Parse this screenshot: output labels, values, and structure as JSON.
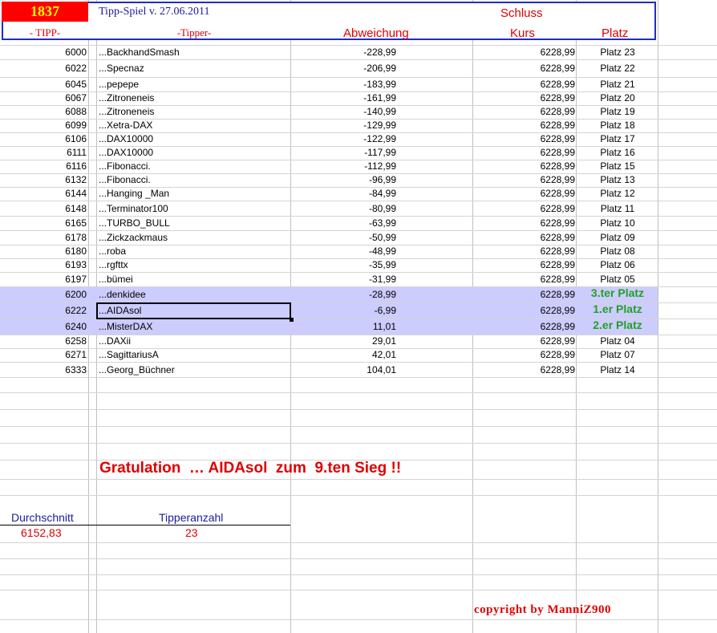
{
  "header": {
    "count": "1837",
    "title": "Tipp-Spiel v. 27.06.2011",
    "schluss": "Schluss",
    "col_tipp": "- TIPP-",
    "col_tipper": "-Tipper-",
    "col_abweichung": "Abweichung",
    "col_kurs": "Kurs",
    "col_platz": "Platz"
  },
  "rows": [
    {
      "tipp": "6000",
      "name": "...BackhandSmash",
      "abw": "-228,99",
      "kurs": "6228,99",
      "platz": "Platz 23"
    },
    {
      "tipp": "6022",
      "name": "...Specnaz",
      "abw": "-206,99",
      "kurs": "6228,99",
      "platz": "Platz 22"
    },
    {
      "tipp": "6045",
      "name": "...pepepe",
      "abw": "-183,99",
      "kurs": "6228,99",
      "platz": "Platz 21"
    },
    {
      "tipp": "6067",
      "name": "...Zitroneneis",
      "abw": "-161,99",
      "kurs": "6228,99",
      "platz": "Platz 20"
    },
    {
      "tipp": "6088",
      "name": "...Zitroneneis",
      "abw": "-140,99",
      "kurs": "6228,99",
      "platz": "Platz 19"
    },
    {
      "tipp": "6099",
      "name": "...Xetra-DAX",
      "abw": "-129,99",
      "kurs": "6228,99",
      "platz": "Platz 18"
    },
    {
      "tipp": "6106",
      "name": "...DAX10000",
      "abw": "-122,99",
      "kurs": "6228,99",
      "platz": "Platz 17"
    },
    {
      "tipp": "6111",
      "name": "...DAX10000",
      "abw": "-117,99",
      "kurs": "6228,99",
      "platz": "Platz 16"
    },
    {
      "tipp": "6116",
      "name": "...Fibonacci.",
      "abw": "-112,99",
      "kurs": "6228,99",
      "platz": "Platz 15"
    },
    {
      "tipp": "6132",
      "name": "...Fibonacci.",
      "abw": "-96,99",
      "kurs": "6228,99",
      "platz": "Platz 13"
    },
    {
      "tipp": "6144",
      "name": "...Hanging _Man",
      "abw": "-84,99",
      "kurs": "6228,99",
      "platz": "Platz 12"
    },
    {
      "tipp": "6148",
      "name": "...Terminator100",
      "abw": "-80,99",
      "kurs": "6228,99",
      "platz": "Platz 11"
    },
    {
      "tipp": "6165",
      "name": "...TURBO_BULL",
      "abw": "-63,99",
      "kurs": "6228,99",
      "platz": "Platz 10"
    },
    {
      "tipp": "6178",
      "name": "...Zickzackmaus",
      "abw": "-50,99",
      "kurs": "6228,99",
      "platz": "Platz 09"
    },
    {
      "tipp": "6180",
      "name": "...roba",
      "abw": "-48,99",
      "kurs": "6228,99",
      "platz": "Platz 08"
    },
    {
      "tipp": "6193",
      "name": "...rgfttx",
      "abw": "-35,99",
      "kurs": "6228,99",
      "platz": "Platz 06"
    },
    {
      "tipp": "6197",
      "name": "...bümei",
      "abw": "-31,99",
      "kurs": "6228,99",
      "platz": "Platz 05"
    },
    {
      "tipp": "6200",
      "name": "...denkidee",
      "abw": "-28,99",
      "kurs": "6228,99",
      "platz": "3.ter Platz"
    },
    {
      "tipp": "6222",
      "name": "...AIDAsol",
      "abw": "-6,99",
      "kurs": "6228,99",
      "platz": "1.er Platz"
    },
    {
      "tipp": "6240",
      "name": "...MisterDAX",
      "abw": "11,01",
      "kurs": "6228,99",
      "platz": "2.er Platz"
    },
    {
      "tipp": "6258",
      "name": "...DAXii",
      "abw": "29,01",
      "kurs": "6228,99",
      "platz": "Platz 04"
    },
    {
      "tipp": "6271",
      "name": "...SagittariusA",
      "abw": "42,01",
      "kurs": "6228,99",
      "platz": "Platz 07"
    },
    {
      "tipp": "6333",
      "name": "...Georg_Büchner",
      "abw": "104,01",
      "kurs": "6228,99",
      "platz": "Platz 14"
    }
  ],
  "congrats": "Gratulation  … AIDAsol  zum  9.ten Sieg !!",
  "stats": {
    "avg_label": "Durchschnitt",
    "avg_value": "6152,83",
    "count_label": "Tipperanzahl",
    "count_value": "23"
  },
  "copyright": "copyright by ManniZ900",
  "colors": {
    "highlight_row": "#ccccff",
    "winner_text": "#22a022",
    "accent_red": "#e00000",
    "header_blue": "#1f2cc8"
  }
}
